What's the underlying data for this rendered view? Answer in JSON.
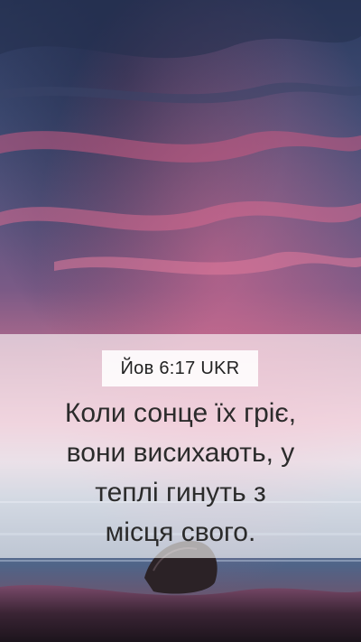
{
  "reference": "Йов 6:17 UKR",
  "verse_lines": [
    "Коли сонце їх гріє,",
    "вони висихають, у",
    "теплі гинуть з",
    "місця свого."
  ],
  "colors": {
    "sky_top": "#2e3a60",
    "sky_mid": "#6a5a8a",
    "cloud_pink": "#c8557a",
    "horizon": "#d88aa6",
    "sea": "#5a6f92",
    "shore": "#2a1e2c",
    "panel": "#ffffff"
  }
}
